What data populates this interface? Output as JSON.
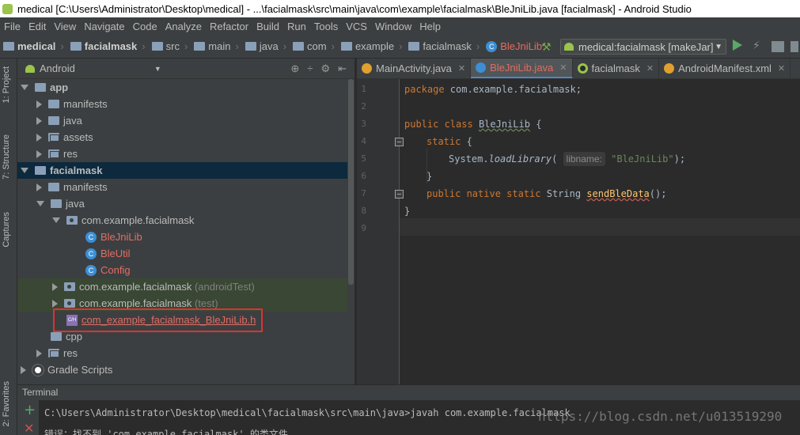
{
  "window": {
    "title": "medical [C:\\Users\\Administrator\\Desktop\\medical] - ...\\facialmask\\src\\main\\java\\com\\example\\facialmask\\BleJniLib.java [facialmask] - Android Studio"
  },
  "menu": [
    "File",
    "Edit",
    "View",
    "Navigate",
    "Code",
    "Analyze",
    "Refactor",
    "Build",
    "Run",
    "Tools",
    "VCS",
    "Window",
    "Help"
  ],
  "breadcrumb": [
    "medical",
    "facialmask",
    "src",
    "main",
    "java",
    "com",
    "example",
    "facialmask",
    "BleJniLib"
  ],
  "toolbar": {
    "run_config": "medical:facialmask [makeJar]"
  },
  "side_tabs": {
    "project": "1: Project",
    "structure": "7: Structure",
    "captures": "Captures",
    "favorites": "2: Favorites"
  },
  "project": {
    "view_mode": "Android",
    "tree": [
      {
        "label": "app",
        "kind": "module",
        "arrow": "down"
      },
      {
        "label": "manifests",
        "kind": "folder",
        "arrow": "right"
      },
      {
        "label": "java",
        "kind": "folder",
        "arrow": "right"
      },
      {
        "label": "assets",
        "kind": "folder",
        "arrow": "right"
      },
      {
        "label": "res",
        "kind": "folder",
        "arrow": "right"
      },
      {
        "label": "facialmask",
        "kind": "module",
        "arrow": "down"
      },
      {
        "label": "manifests",
        "kind": "folder",
        "arrow": "right"
      },
      {
        "label": "java",
        "kind": "folder",
        "arrow": "down"
      },
      {
        "label": "com.example.facialmask",
        "kind": "package",
        "arrow": "down"
      },
      {
        "label": "BleJniLib",
        "kind": "class"
      },
      {
        "label": "BleUtil",
        "kind": "class"
      },
      {
        "label": "Config",
        "kind": "class"
      },
      {
        "label": "com.example.facialmask",
        "suffix": "(androidTest)",
        "kind": "package",
        "arrow": "right"
      },
      {
        "label": "com.example.facialmask",
        "suffix": "(test)",
        "kind": "package",
        "arrow": "right"
      },
      {
        "label": "com_example_facialmask_BleJniLib.h",
        "kind": "header"
      },
      {
        "label": "cpp",
        "kind": "folder"
      },
      {
        "label": "res",
        "kind": "folder",
        "arrow": "right"
      },
      {
        "label": "Gradle Scripts",
        "kind": "gradle",
        "arrow": "right"
      }
    ]
  },
  "editor": {
    "tabs": [
      {
        "label": "MainActivity.java",
        "icon": "orange"
      },
      {
        "label": "BleJniLib.java",
        "icon": "blue",
        "active": true
      },
      {
        "label": "facialmask",
        "icon": "green"
      },
      {
        "label": "AndroidManifest.xml",
        "icon": "orange"
      }
    ],
    "line_numbers": [
      "1",
      "2",
      "3",
      "4",
      "5",
      "6",
      "7",
      "8",
      "9"
    ],
    "code": {
      "l1_kw": "package",
      "l1_rest": " com.example.facialmask;",
      "l3_kw": "public class",
      "l3_cls": "BleJniLib",
      "l3_rest": " {",
      "l4_kw": "static",
      "l4_rest": " {",
      "l5_a": "System.",
      "l5_m": "loadLibrary",
      "l5_b": "(",
      "l5_hint": "libname:",
      "l5_str": "\"BleJniLib\"",
      "l5_c": ");",
      "l6": "}",
      "l7_kw": "public native static",
      "l7_type": " String ",
      "l7_m": "sendBleData",
      "l7_rest": "();",
      "l8": "}"
    }
  },
  "terminal": {
    "title": "Terminal",
    "line1": "C:\\Users\\Administrator\\Desktop\\medical\\facialmask\\src\\main\\java>javah com.example.facialmask",
    "line2": "错误：找不到 'com.example.facialmask' 的类文件"
  },
  "watermark": "https://blog.csdn.net/u013519290"
}
